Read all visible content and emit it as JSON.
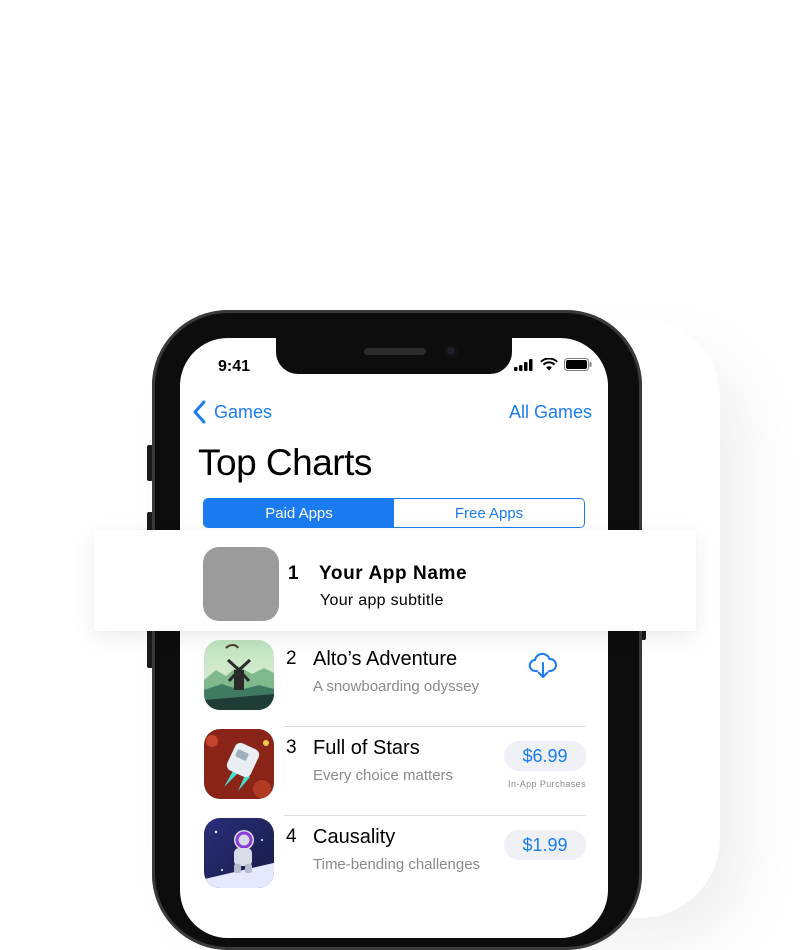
{
  "status_bar": {
    "time": "9:41"
  },
  "nav": {
    "back_label": "Games",
    "right_label": "All Games"
  },
  "page_title": "Top Charts",
  "segments": [
    {
      "label": "Paid Apps",
      "active": true
    },
    {
      "label": "Free Apps",
      "active": false
    }
  ],
  "featured": {
    "rank": "1",
    "name": "Your App Name",
    "subtitle": "Your app subtitle"
  },
  "apps": [
    {
      "rank": "2",
      "name": "Alto’s Adventure",
      "subtitle": "A snowboarding odyssey",
      "action": "download-cloud-icon"
    },
    {
      "rank": "3",
      "name": "Full of Stars",
      "subtitle": "Every choice matters",
      "price": "$6.99",
      "note": "In-App Purchases"
    },
    {
      "rank": "4",
      "name": "Causality",
      "subtitle": "Time-bending challenges",
      "price": "$1.99"
    }
  ],
  "colors": {
    "accent": "#1a7cf0",
    "placeholder": "#9b9b9b",
    "secondary_text": "#8a8a8e"
  }
}
